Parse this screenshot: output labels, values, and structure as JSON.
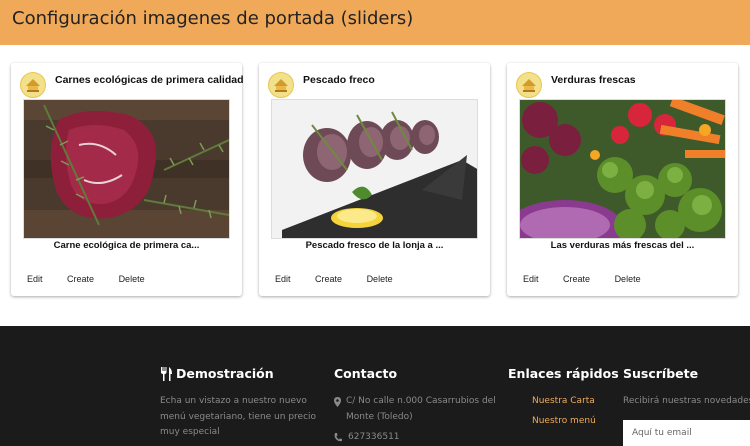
{
  "header": {
    "title": "Configuración imagenes de portada (sliders)"
  },
  "cards": [
    {
      "title": "Carnes ecológicas de primera calidad",
      "caption": "Carne ecológica de primera ca...",
      "image": "raw-beef-with-rosemary"
    },
    {
      "title": "Pescado freco",
      "caption": "Pescado fresco de la lonja a ...",
      "image": "fish-slices-with-lemon"
    },
    {
      "title": "Verduras frescas",
      "caption": "Las verduras más frescas del ...",
      "image": "fresh-vegetables-bowl"
    }
  ],
  "card_actions": {
    "edit": "Edit",
    "create": "Create",
    "delete": "Delete"
  },
  "footer": {
    "demo": {
      "title": "Demostración",
      "icon": "utensils-icon",
      "text": "Echa un vistazo a nuestro nuevo menú vegetariano, tiene un precio muy especial"
    },
    "contact": {
      "title": "Contacto",
      "address": "C/ No calle n.000 Casarrubios del Monte (Toledo)",
      "phone": "627336511"
    },
    "quick_links": {
      "title": "Enlaces rápidos",
      "items": [
        "Nuestra Carta",
        "Nuestro menú"
      ]
    },
    "subscribe": {
      "title": "Suscríbete",
      "text": "Recibirá nuestras novedades",
      "placeholder": "Aquí tu email"
    }
  },
  "colors": {
    "accent": "#f0a959",
    "footer_bg": "#1b1b1b"
  }
}
